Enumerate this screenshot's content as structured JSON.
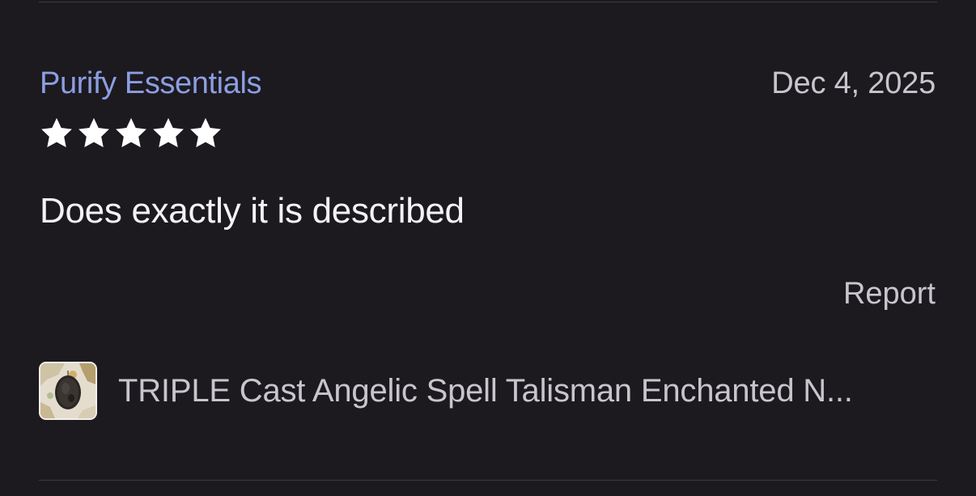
{
  "review": {
    "reviewer_name": "Purify Essentials",
    "date": "Dec 4, 2025",
    "rating": 5,
    "rating_max": 5,
    "text": "Does exactly it is described",
    "report_label": "Report"
  },
  "item": {
    "title": "TRIPLE Cast Angelic Spell Talisman Enchanted N...",
    "thumbnail_icon": "product-thumbnail"
  },
  "colors": {
    "background": "#1c1a1f",
    "reviewer_link": "#8c9ee2",
    "primary_text": "#f4f2f6",
    "secondary_text": "#c9c5cc",
    "star": "#ffffff",
    "divider": "#3c3942"
  }
}
